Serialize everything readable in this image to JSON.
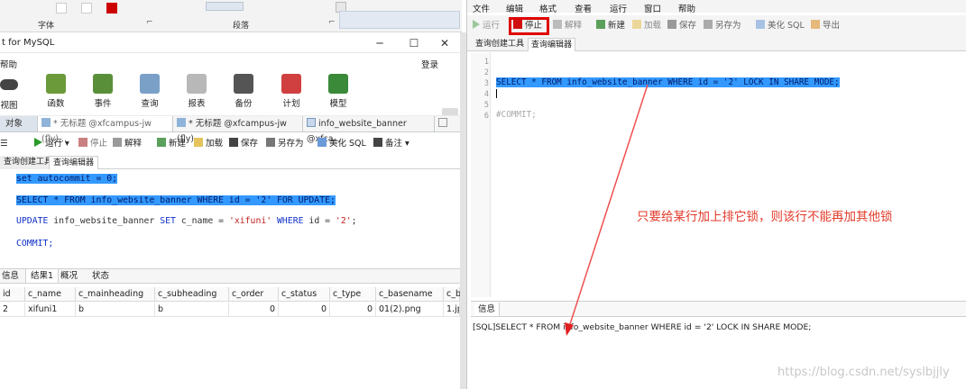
{
  "left": {
    "ribbon": {
      "group1": "字体",
      "group2": "段落"
    },
    "title": "t for MySQL",
    "menu_help": "帮助",
    "login": "登录",
    "main_buttons": [
      "视图",
      "函数",
      "事件",
      "查询",
      "报表",
      "备份",
      "计划",
      "模型"
    ],
    "tabs": [
      "对象",
      "* 无标题 @xfcampus-jw (fly)...",
      "* 无标题 @xfcampus-jw (fly)...",
      "info_website_banner @xfca..."
    ],
    "toolbar": {
      "run": "运行",
      "stop": "停止",
      "explain": "解释",
      "new": "新建",
      "load": "加载",
      "save": "保存",
      "save_as": "另存为",
      "beautify": "美化 SQL",
      "note": "备注"
    },
    "subtabs": [
      "查询创建工具",
      "查询编辑器"
    ],
    "code": {
      "l1": "set autocommit = 0;",
      "l2": "SELECT * FROM info_website_banner WHERE id = '2' FOR UPDATE;",
      "l3_kw1": "UPDATE",
      "l3_mid": " info_website_banner ",
      "l3_kw2": "SET",
      "l3_mid2": " c_name = ",
      "l3_str1": "'xifuni'",
      "l3_kw3": " WHERE",
      "l3_mid3": " id = ",
      "l3_str2": "'2'",
      "l3_end": ";",
      "l4": "COMMIT;"
    },
    "result_tabs": [
      "信息",
      "结果1",
      "概况",
      "状态"
    ],
    "columns": [
      "id",
      "c_name",
      "c_mainheading",
      "c_subheading",
      "c_order",
      "c_status",
      "c_type",
      "c_basename",
      "c_b"
    ],
    "row": [
      "2",
      "xifuni1",
      "b",
      "b",
      "0",
      "0",
      "0",
      "01(2).png",
      "1.jp"
    ]
  },
  "right": {
    "menu": [
      "文件",
      "编辑",
      "格式",
      "查看",
      "运行",
      "窗口",
      "帮助"
    ],
    "toolbar": {
      "run": "运行",
      "stop": "停止",
      "explain": "解释",
      "new": "新建",
      "load": "加载",
      "save": "保存",
      "save_as": "另存为",
      "beautify": "美化 SQL",
      "export": "导出"
    },
    "subtabs": [
      "查询创建工具",
      "查询编辑器"
    ],
    "line_numbers": [
      "1",
      "2",
      "3",
      "4",
      "5",
      "6"
    ],
    "code_selected": "SELECT * FROM info_website_banner WHERE id = '2' LOCK IN SHARE MODE;",
    "code_comment": "#COMMIT;",
    "info_tab": "信息",
    "info_text": "[SQL]SELECT * FROM info_website_banner WHERE id = '2' LOCK IN SHARE MODE;"
  },
  "annotation": "只要给某行加上排它锁，则该行不能再加其他锁",
  "watermark": "https://blog.csdn.net/syslbjjly",
  "colors": {
    "selection": "#3399ff",
    "highlight_box": "#e00000",
    "annotation": "#e23a2a",
    "keyword": "#1030c8",
    "string": "#c02020"
  }
}
